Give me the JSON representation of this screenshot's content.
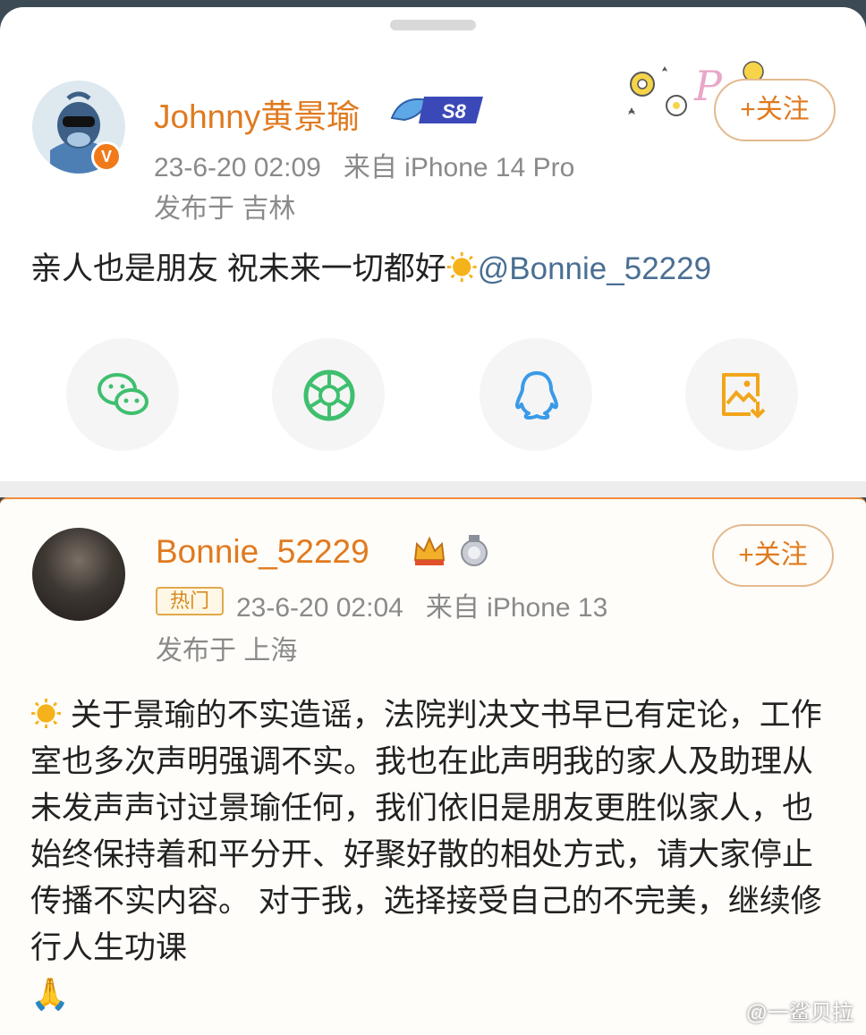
{
  "post1": {
    "username": "Johnny黄景瑜",
    "level_badge": "S8",
    "verified_badge": "V",
    "timestamp": "23-6-20 02:09",
    "source": "来自 iPhone 14 Pro",
    "location": "发布于 吉林",
    "content_text": "亲人也是朋友 祝未来一切都好",
    "emoji": "☀",
    "mention": "@Bonnie_52229",
    "follow_label": "+关注"
  },
  "share_icons": [
    "wechat-icon",
    "moments-icon",
    "qq-icon",
    "save-image-icon"
  ],
  "post2": {
    "username": "Bonnie_52229",
    "hot_tag": "热门",
    "timestamp": "23-6-20 02:04",
    "source": "来自 iPhone 13",
    "location": "发布于 上海",
    "follow_label": "+关注",
    "emoji": "☀",
    "content_text": "关于景瑜的不实造谣，法院判决文书早已有定论，工作室也多次声明强调不实。我也在此声明我的家人及助理从未发声声讨过景瑜任何，我们依旧是朋友更胜似家人，也始终保持着和平分开、好聚好散的相处方式，请大家停止传播不实内容。 对于我，选择接受自己的不完美，继续修行人生功课",
    "end_emoji": "🙏"
  },
  "watermark": "@一鲨贝拉",
  "colors": {
    "accent": "#e07a1f",
    "mention": "#4a6f93",
    "meta": "#8a8a8a"
  }
}
